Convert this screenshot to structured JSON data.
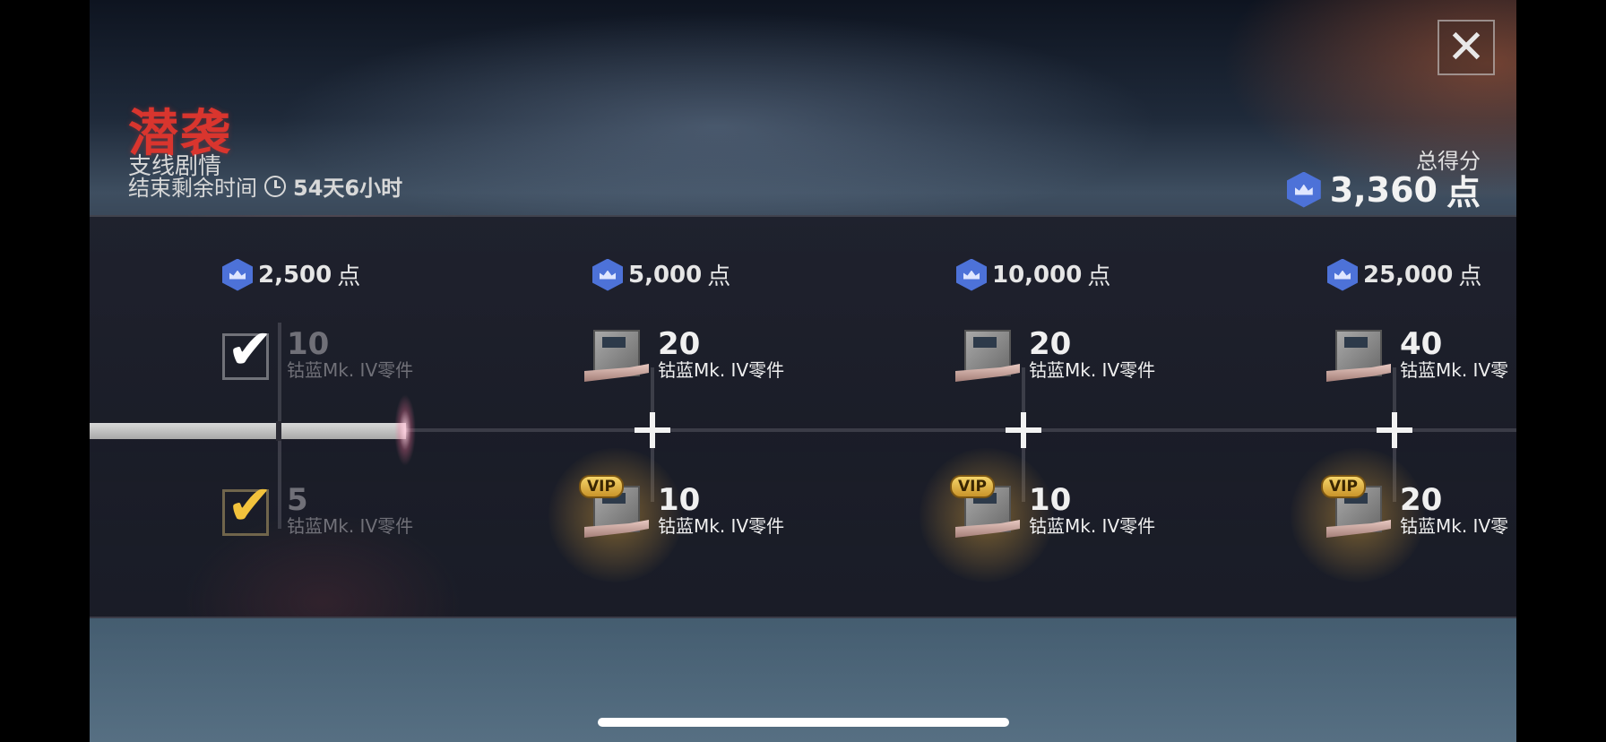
{
  "event": {
    "title": "潜袭",
    "subtitle": "支线剧情",
    "time_label": "结束剩余时间",
    "time_value": "54天6小时"
  },
  "close_label": "✕",
  "total": {
    "label": "总得分",
    "value": "3,360",
    "unit": "点"
  },
  "progress": {
    "current_points": 3360,
    "tier_thresholds": [
      2500,
      5000,
      10000,
      25000
    ]
  },
  "tiers": [
    {
      "points": "2,500",
      "unit": "点",
      "free": {
        "qty": "10",
        "name": "钴蓝Mk. IV零件",
        "claimed": true
      },
      "vip": {
        "qty": "5",
        "name": "钴蓝Mk. IV零件",
        "claimed": true
      }
    },
    {
      "points": "5,000",
      "unit": "点",
      "free": {
        "qty": "20",
        "name": "钴蓝Mk. IV零件",
        "claimed": false
      },
      "vip": {
        "qty": "10",
        "name": "钴蓝Mk. IV零件",
        "claimed": false,
        "badge": "VIP"
      }
    },
    {
      "points": "10,000",
      "unit": "点",
      "free": {
        "qty": "20",
        "name": "钴蓝Mk. IV零件",
        "claimed": false
      },
      "vip": {
        "qty": "10",
        "name": "钴蓝Mk. IV零件",
        "claimed": false,
        "badge": "VIP"
      }
    },
    {
      "points": "25,000",
      "unit": "点",
      "free": {
        "qty": "40",
        "name": "钴蓝Mk. IV零",
        "claimed": false
      },
      "vip": {
        "qty": "20",
        "name": "钴蓝Mk. IV零",
        "claimed": false,
        "badge": "VIP"
      }
    }
  ],
  "colors": {
    "title_red": "#d9352e",
    "points_blue": "#4d72d8",
    "vip_gold": "#f2c23c"
  },
  "icons": {
    "points": "hexagon-crown-icon",
    "clock": "clock-icon",
    "check": "checkmark-icon",
    "plus": "plus-icon"
  }
}
